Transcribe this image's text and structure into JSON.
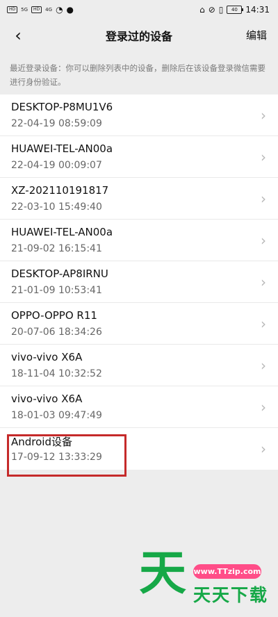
{
  "status_bar": {
    "left_chips": [
      "HD",
      "HD"
    ],
    "signal_labels": [
      "5G",
      "4G"
    ],
    "time": "14:31",
    "battery": "40"
  },
  "nav": {
    "back_icon": "back-chevron-icon",
    "title": "登录过的设备",
    "edit_label": "编辑"
  },
  "description": "最近登录设备：你可以删除列表中的设备，删除后在该设备登录微信需要进行身份验证。",
  "devices": [
    {
      "name": "DESKTOP-P8MU1V6",
      "time": "22-04-19 08:59:09"
    },
    {
      "name": "HUAWEI-TEL-AN00a",
      "time": "22-04-19 00:09:07"
    },
    {
      "name": "XZ-202110191817",
      "time": "22-03-10 15:49:40"
    },
    {
      "name": "HUAWEI-TEL-AN00a",
      "time": "21-09-02 16:15:41"
    },
    {
      "name": "DESKTOP-AP8IRNU",
      "time": "21-01-09 10:53:41"
    },
    {
      "name": "OPPO-OPPO R11",
      "time": "20-07-06 18:34:26"
    },
    {
      "name": "vivo-vivo X6A",
      "time": "18-11-04 10:32:52"
    },
    {
      "name": "vivo-vivo X6A",
      "time": "18-01-03 09:47:49"
    },
    {
      "name": "Android设备",
      "time": "17-09-12 13:33:29"
    }
  ],
  "watermark": {
    "logo": "天",
    "url": "www.TTzip.com",
    "text": "天天下载"
  },
  "colors": {
    "highlight": "#c52a2a",
    "watermark_green": "#16a847",
    "watermark_pink": "#ff4d88"
  }
}
